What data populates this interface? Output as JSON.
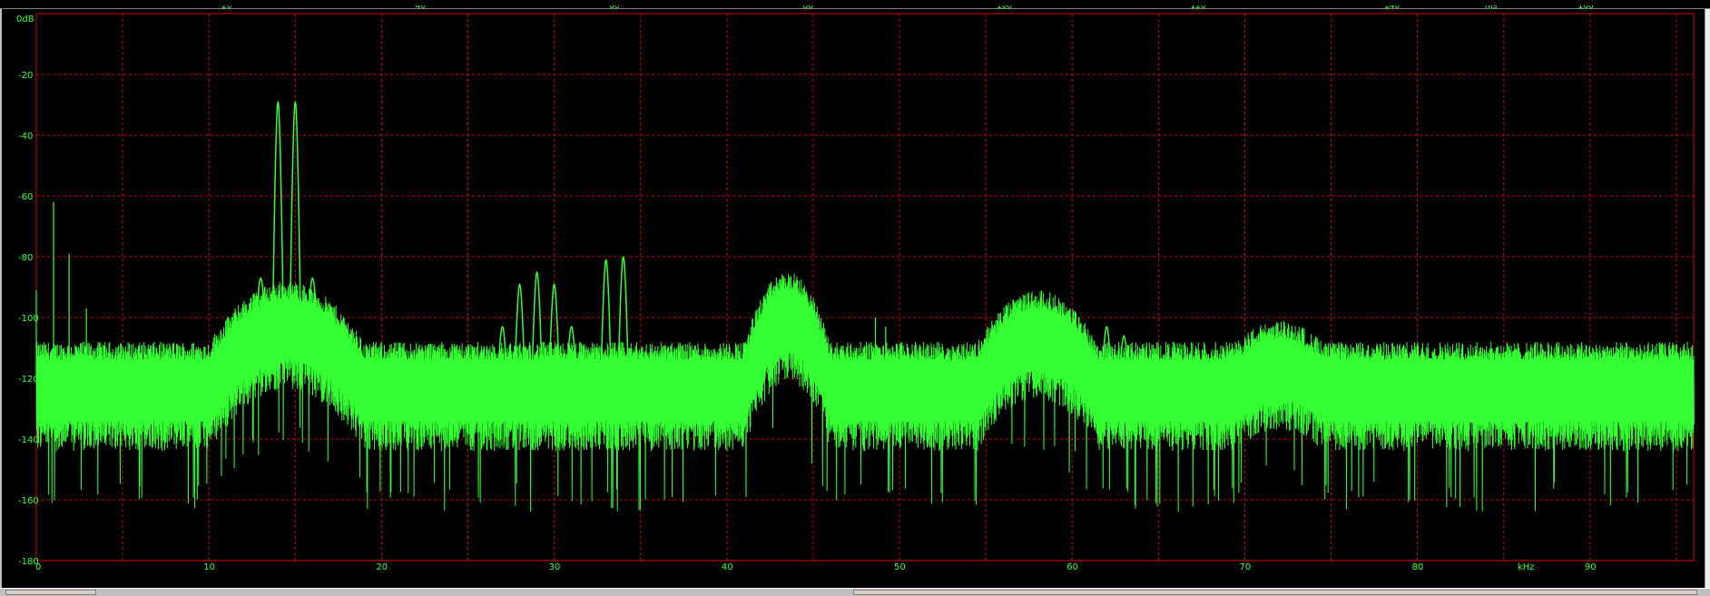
{
  "window": {
    "background": "#000000",
    "plot_border_color": "#cc0000",
    "grid_color": "#cc0000",
    "trace_color": "#33ff33"
  },
  "top_axis": {
    "ticks": [
      "20",
      "40",
      "60",
      "80",
      "100",
      "120",
      "140",
      "160"
    ],
    "unit_label": "ms"
  },
  "chart_data": {
    "type": "line",
    "title": "",
    "xlabel": "kHz",
    "ylabel": "0dB",
    "xlim": [
      0,
      96
    ],
    "ylim": [
      -180,
      0
    ],
    "x_ticks": [
      0,
      10,
      20,
      30,
      40,
      50,
      60,
      70,
      80,
      90
    ],
    "x_tick_labels": [
      "0",
      "10",
      "20",
      "30",
      "40",
      "50",
      "60",
      "70",
      "80",
      "90"
    ],
    "y_ticks": [
      -20,
      -40,
      -60,
      -80,
      -100,
      -120,
      -140,
      -160,
      -180
    ],
    "y_tick_labels": [
      "-20",
      "-40",
      "-60",
      "-80",
      "-100",
      "-120",
      "-140",
      "-160",
      "-180"
    ],
    "grid": true,
    "series": [
      {
        "floor_db": -120,
        "spikes": [
          {
            "x": 0.0,
            "y": -91
          },
          {
            "x": 1.0,
            "y": -62
          },
          {
            "x": 1.9,
            "y": -79
          },
          {
            "x": 2.9,
            "y": -97
          },
          {
            "x": 48.6,
            "y": -100
          },
          {
            "x": 49.2,
            "y": -103
          }
        ],
        "peaks": [
          {
            "x": 13.0,
            "y": -87
          },
          {
            "x": 14.0,
            "y": -29
          },
          {
            "x": 15.0,
            "y": -29
          },
          {
            "x": 16.0,
            "y": -87
          },
          {
            "x": 27.0,
            "y": -103
          },
          {
            "x": 28.0,
            "y": -89
          },
          {
            "x": 29.0,
            "y": -85
          },
          {
            "x": 30.0,
            "y": -89
          },
          {
            "x": 31.0,
            "y": -103
          },
          {
            "x": 33.0,
            "y": -81
          },
          {
            "x": 34.0,
            "y": -80
          },
          {
            "x": 42.0,
            "y": -102
          },
          {
            "x": 43.0,
            "y": -97
          },
          {
            "x": 44.0,
            "y": -97
          },
          {
            "x": 45.0,
            "y": -102
          },
          {
            "x": 57.0,
            "y": -106
          },
          {
            "x": 58.0,
            "y": -103
          },
          {
            "x": 59.0,
            "y": -106
          },
          {
            "x": 62.0,
            "y": -103
          },
          {
            "x": 63.0,
            "y": -106
          }
        ],
        "humps": [
          {
            "x": 14.5,
            "y": -100,
            "width": 4.5
          },
          {
            "x": 43.5,
            "y": -97,
            "width": 2.5
          },
          {
            "x": 58.0,
            "y": -103,
            "width": 3.5
          },
          {
            "x": 72.0,
            "y": -113,
            "width": 2.5
          }
        ]
      }
    ]
  }
}
